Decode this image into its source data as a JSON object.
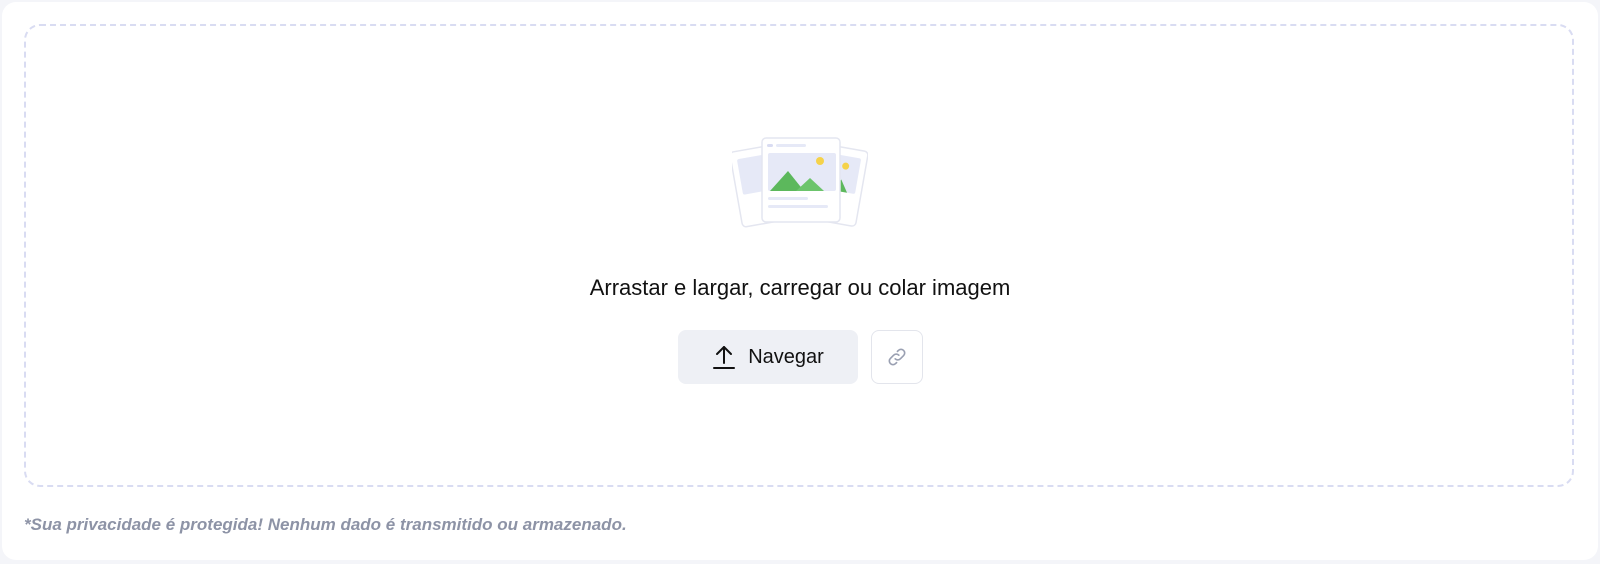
{
  "dropzone": {
    "prompt": "Arrastar e largar, carregar ou colar imagem",
    "browse_label": "Navegar",
    "upload_icon": "upload-arrow-icon",
    "link_icon": "link-icon",
    "illustration": "image-stack-illustration"
  },
  "footer": {
    "privacy_note": "*Sua privacidade é protegida! Nenhum dado é transmitido ou armazenado."
  },
  "colors": {
    "border_dashed": "#d9dcf2",
    "button_bg": "#eef0f5",
    "mountain_green": "#5cb85c",
    "sun_yellow": "#f5d24a",
    "note_gray": "#8d93a6"
  }
}
